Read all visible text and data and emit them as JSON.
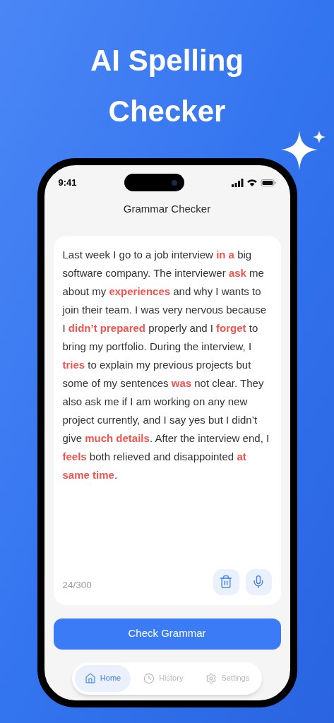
{
  "headline": [
    "AI Spelling",
    "Checker"
  ],
  "status_bar": {
    "time": "9:41"
  },
  "screen_title": "Grammar Checker",
  "editor": {
    "segments": [
      {
        "text": "Last week I go to a job interview ",
        "error": false
      },
      {
        "text": "in a",
        "error": true
      },
      {
        "text": " big software company. The interviewer ",
        "error": false
      },
      {
        "text": "ask",
        "error": true
      },
      {
        "text": " me about my ",
        "error": false
      },
      {
        "text": "experiences",
        "error": true
      },
      {
        "text": " and why I wants to join their team. I was very nervous because I ",
        "error": false
      },
      {
        "text": "didn’t prepared",
        "error": true
      },
      {
        "text": " properly and I ",
        "error": false
      },
      {
        "text": "forget",
        "error": true
      },
      {
        "text": " to bring my portfolio. During the interview, I ",
        "error": false
      },
      {
        "text": "tries",
        "error": true
      },
      {
        "text": " to explain my previous projects but some of my sentences ",
        "error": false
      },
      {
        "text": "was",
        "error": true
      },
      {
        "text": " not clear. They also ask me if I am working on any new project currently, and I say yes but I didn’t give ",
        "error": false
      },
      {
        "text": "much details",
        "error": true
      },
      {
        "text": ". After the interview end, I ",
        "error": false
      },
      {
        "text": "feels",
        "error": true
      },
      {
        "text": " both relieved and disappointed ",
        "error": false
      },
      {
        "text": "at same time",
        "error": true
      },
      {
        "text": ".",
        "error": false
      }
    ],
    "counter": "24/300"
  },
  "primary_button": "Check Grammar",
  "tabs": [
    {
      "kind": "home",
      "label": "Home",
      "selected": true
    },
    {
      "kind": "history",
      "label": "History",
      "selected": false
    },
    {
      "kind": "settings",
      "label": "Settings",
      "selected": false
    }
  ]
}
